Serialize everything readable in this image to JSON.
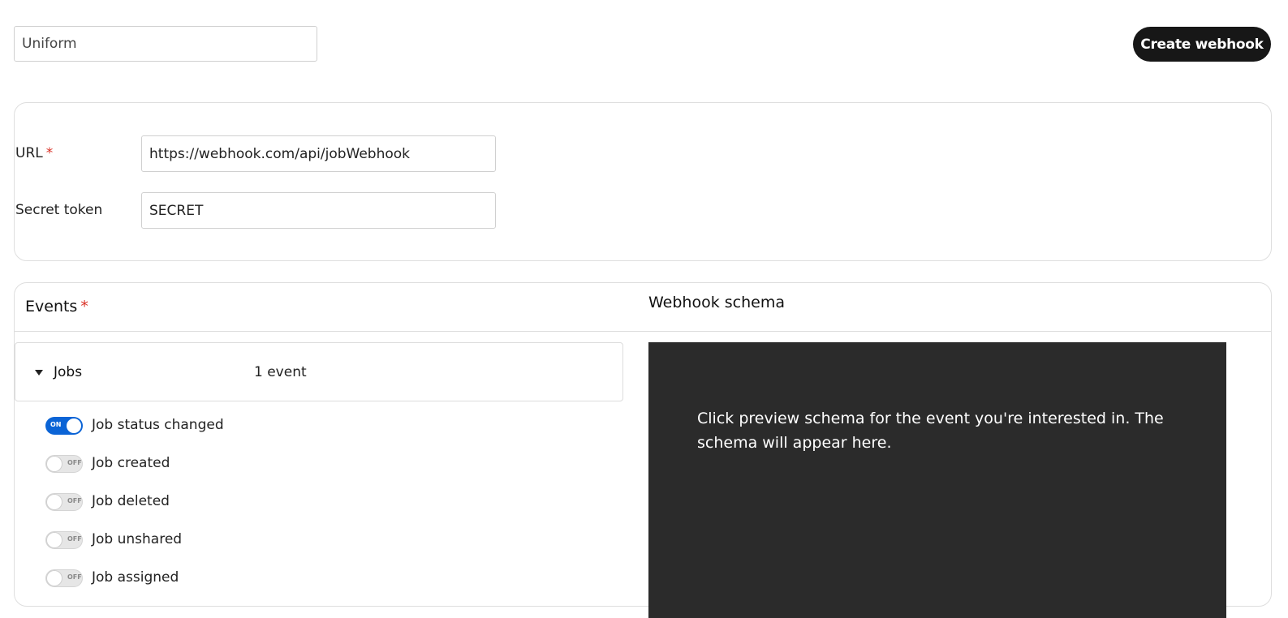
{
  "header": {
    "name_value": "Uniform",
    "create_label": "Create webhook"
  },
  "config": {
    "url_label": "URL",
    "url_required": "*",
    "url_value": "https://webhook.com/api/jobWebhook",
    "secret_label": "Secret token",
    "secret_value": "SECRET"
  },
  "events": {
    "title": "Events",
    "required": "*",
    "group": {
      "name": "Jobs",
      "count": "1 event"
    },
    "items": [
      {
        "label": "Job status changed",
        "state": "ON",
        "enabled": true
      },
      {
        "label": "Job created",
        "state": "OFF",
        "enabled": false
      },
      {
        "label": "Job deleted",
        "state": "OFF",
        "enabled": false
      },
      {
        "label": "Job unshared",
        "state": "OFF",
        "enabled": false
      },
      {
        "label": "Job assigned",
        "state": "OFF",
        "enabled": false
      }
    ]
  },
  "schema": {
    "title": "Webhook schema",
    "placeholder": "Click preview schema for the event you're interested in. The schema will appear here."
  },
  "colors": {
    "primary_button": "#171717",
    "toggle_on": "#0b64d6",
    "required": "#d93025",
    "schema_bg": "#2b2b2b"
  }
}
